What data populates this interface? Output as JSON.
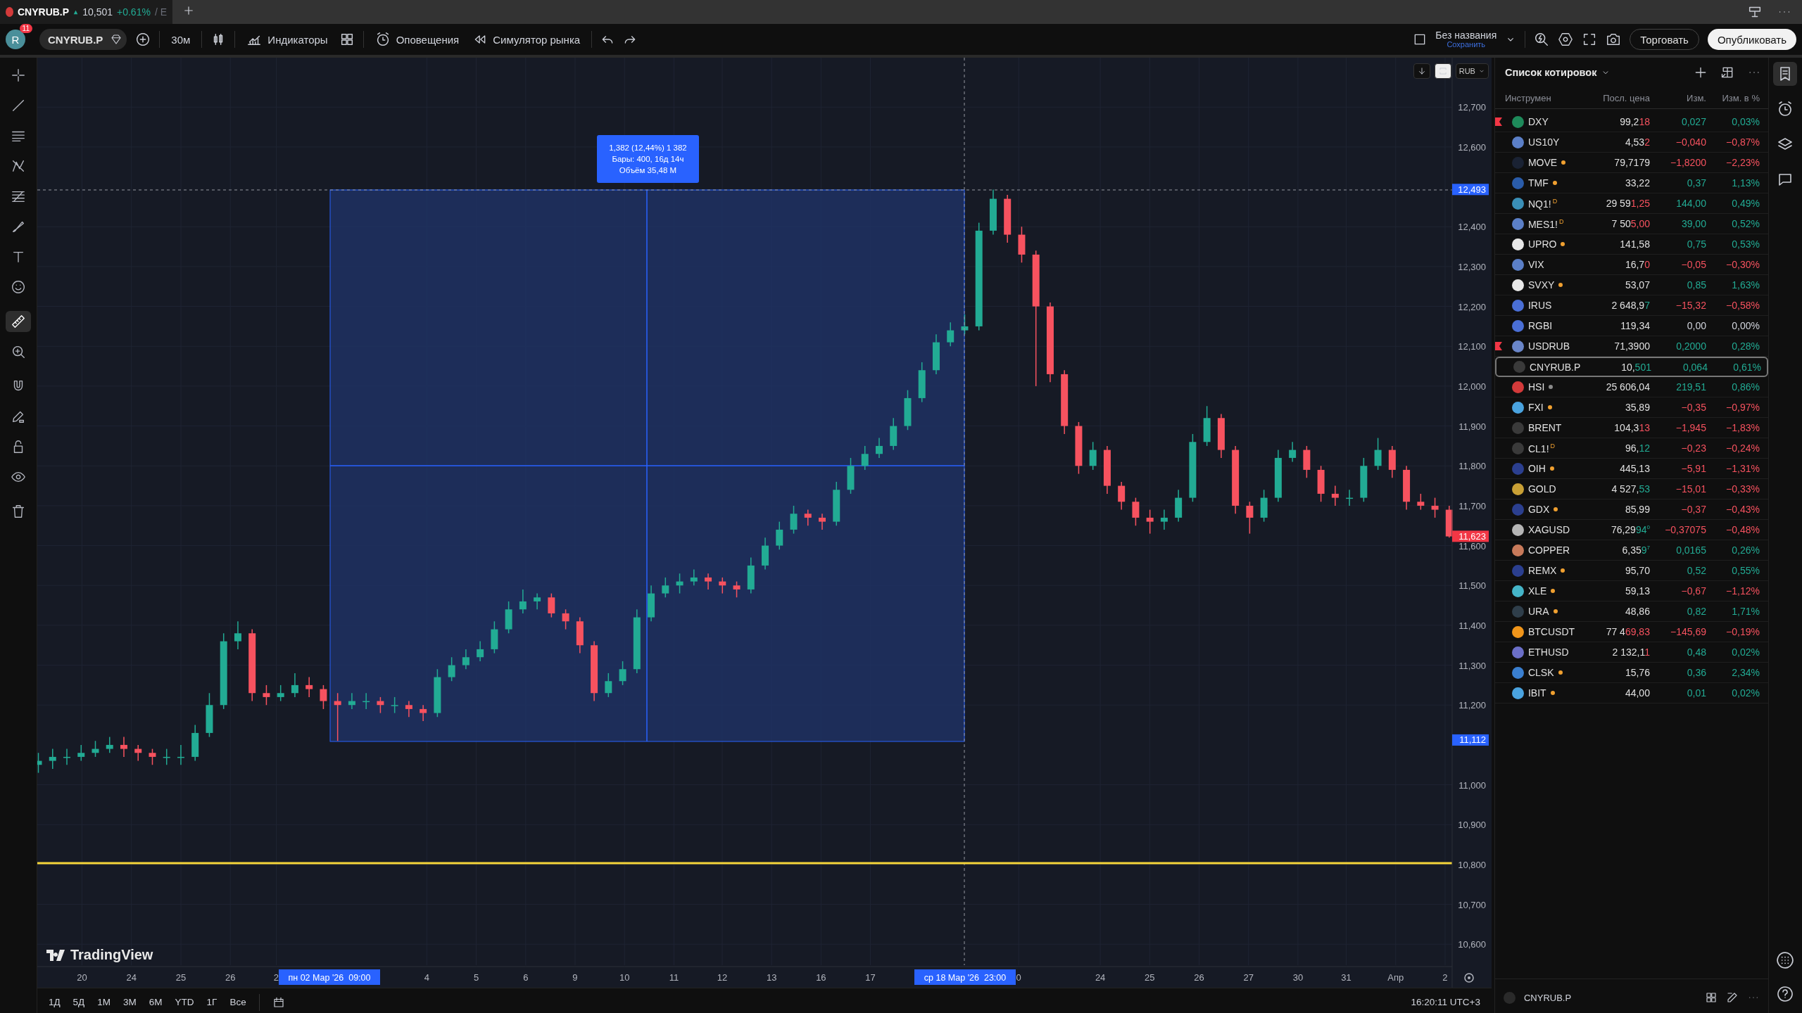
{
  "tab": {
    "symbol": "CNYRUB.P",
    "price": "10,501",
    "change": "+0.61%",
    "suffix": "/ E"
  },
  "toolbar": {
    "avatar": "R",
    "notifications": "11",
    "symbol": "CNYRUB.P",
    "interval": "30м",
    "indicators": "Индикаторы",
    "alerts": "Оповещения",
    "replay": "Симулятор рынка"
  },
  "layout": {
    "name": "Без названия",
    "save": "Сохранить",
    "trade": "Торговать",
    "publish": "Опубликовать"
  },
  "tools": [
    {
      "selected": false
    },
    {
      "selected": false
    },
    {
      "selected": false
    },
    {
      "selected": false
    },
    {
      "selected": false
    },
    {
      "selected": false
    },
    {
      "selected": false
    },
    {
      "selected": false
    },
    {
      "selected": true
    },
    {
      "selected": false
    },
    {
      "selected": false
    },
    {
      "selected": false
    },
    {
      "selected": false
    },
    {
      "selected": false
    },
    {
      "selected": false
    }
  ],
  "chart": {
    "currency": "RUB",
    "price_markers": [
      {
        "label": "12,493",
        "kind": "measure"
      },
      {
        "label": "11,623",
        "kind": "last"
      },
      {
        "label": "11,112",
        "kind": "measure"
      }
    ],
    "measure": [
      "1,382 (12,44%) 1 382",
      "Бары: 400, 16д 14ч",
      "Объём 35,48 M"
    ],
    "time_axis": [
      "20",
      "24",
      "25",
      "26",
      "2",
      "4",
      "5",
      "6",
      "9",
      "10",
      "11",
      "12",
      "13",
      "16",
      "17",
      "0",
      "24",
      "25",
      "26",
      "27",
      "30",
      "31",
      "Апр",
      "2"
    ],
    "time_markers": [
      "пн 02 Мар '26  09:00",
      "ср 18 Мар '26  23:00"
    ],
    "logo": "TradingView",
    "chart_data": {
      "type": "candlestick",
      "categories": [
        null,
        null,
        null,
        null,
        null,
        null,
        null,
        null,
        null,
        null,
        null,
        null,
        null,
        null,
        null,
        null,
        null,
        null,
        null,
        null,
        null,
        null,
        null,
        null,
        null,
        null,
        null,
        null,
        null,
        null,
        null,
        null,
        null,
        null,
        null,
        null,
        null,
        null,
        null,
        null,
        null,
        null,
        null,
        null,
        null,
        null,
        null,
        null,
        null,
        null,
        null,
        null,
        null,
        null,
        null,
        null,
        null,
        null,
        null,
        null,
        null,
        null,
        null,
        null,
        null,
        null,
        null,
        null,
        null,
        null,
        null,
        null,
        null,
        null,
        null,
        null,
        null,
        null,
        null,
        null,
        null,
        null,
        null,
        null,
        null,
        null,
        null,
        null,
        null,
        null,
        null,
        null,
        null,
        null,
        null,
        null,
        null,
        null,
        null,
        null
      ],
      "ylim": [
        10.491,
        12.824
      ],
      "yticks": [
        {
          "value": 12.7,
          "label": "12,700"
        },
        {
          "value": 12.6,
          "label": "12,600"
        },
        {
          "value": 12.4,
          "label": "12,400"
        },
        {
          "value": 12.3,
          "label": "12,300"
        },
        {
          "value": 12.2,
          "label": "12,200"
        },
        {
          "value": 12.1,
          "label": "12,100"
        },
        {
          "value": 12.0,
          "label": "12,000"
        },
        {
          "value": 11.9,
          "label": "11,900"
        },
        {
          "value": 11.8,
          "label": "11,800"
        },
        {
          "value": 11.7,
          "label": "11,700"
        },
        {
          "value": 11.6,
          "label": "11,600"
        },
        {
          "value": 11.5,
          "label": "11,500"
        },
        {
          "value": 11.4,
          "label": "11,400"
        },
        {
          "value": 11.3,
          "label": "11,300"
        },
        {
          "value": 11.2,
          "label": "11,200"
        },
        {
          "value": 11.0,
          "label": "11,000"
        },
        {
          "value": 10.9,
          "label": "10,900"
        },
        {
          "value": 10.8,
          "label": "10,800"
        },
        {
          "value": 10.7,
          "label": "10,700"
        },
        {
          "value": 10.6,
          "label": "10,600"
        }
      ],
      "ohlc": [
        [
          11.05,
          11.08,
          11.03,
          11.06
        ],
        [
          11.06,
          11.09,
          11.04,
          11.07
        ],
        [
          11.07,
          11.09,
          11.05,
          11.07
        ],
        [
          11.07,
          11.1,
          11.06,
          11.08
        ],
        [
          11.08,
          11.11,
          11.07,
          11.09
        ],
        [
          11.09,
          11.12,
          11.08,
          11.1
        ],
        [
          11.1,
          11.12,
          11.07,
          11.09
        ],
        [
          11.09,
          11.1,
          11.06,
          11.08
        ],
        [
          11.08,
          11.09,
          11.05,
          11.07
        ],
        [
          11.07,
          11.09,
          11.05,
          11.07
        ],
        [
          11.07,
          11.1,
          11.05,
          11.07
        ],
        [
          11.07,
          11.15,
          11.06,
          11.13
        ],
        [
          11.13,
          11.23,
          11.12,
          11.2
        ],
        [
          11.2,
          11.38,
          11.19,
          11.36
        ],
        [
          11.36,
          11.41,
          11.34,
          11.38
        ],
        [
          11.38,
          11.39,
          11.21,
          11.23
        ],
        [
          11.23,
          11.25,
          11.2,
          11.22
        ],
        [
          11.22,
          11.25,
          11.21,
          11.23
        ],
        [
          11.23,
          11.28,
          11.22,
          11.25
        ],
        [
          11.25,
          11.27,
          11.22,
          11.24
        ],
        [
          11.24,
          11.25,
          11.19,
          11.21
        ],
        [
          11.21,
          11.23,
          11.11,
          11.2
        ],
        [
          11.2,
          11.23,
          11.19,
          11.21
        ],
        [
          11.21,
          11.23,
          11.19,
          11.21
        ],
        [
          11.21,
          11.22,
          11.18,
          11.2
        ],
        [
          11.2,
          11.22,
          11.18,
          11.2
        ],
        [
          11.2,
          11.21,
          11.17,
          11.19
        ],
        [
          11.19,
          11.2,
          11.16,
          11.18
        ],
        [
          11.18,
          11.29,
          11.17,
          11.27
        ],
        [
          11.27,
          11.32,
          11.26,
          11.3
        ],
        [
          11.3,
          11.34,
          11.29,
          11.32
        ],
        [
          11.32,
          11.36,
          11.31,
          11.34
        ],
        [
          11.34,
          11.41,
          11.33,
          11.39
        ],
        [
          11.39,
          11.46,
          11.38,
          11.44
        ],
        [
          11.44,
          11.49,
          11.43,
          11.46
        ],
        [
          11.46,
          11.48,
          11.44,
          11.47
        ],
        [
          11.47,
          11.48,
          11.42,
          11.43
        ],
        [
          11.43,
          11.44,
          11.39,
          11.41
        ],
        [
          11.41,
          11.42,
          11.33,
          11.35
        ],
        [
          11.35,
          11.36,
          11.21,
          11.23
        ],
        [
          11.23,
          11.28,
          11.22,
          11.26
        ],
        [
          11.26,
          11.31,
          11.25,
          11.29
        ],
        [
          11.29,
          11.44,
          11.28,
          11.42
        ],
        [
          11.42,
          11.5,
          11.41,
          11.48
        ],
        [
          11.48,
          11.52,
          11.47,
          11.5
        ],
        [
          11.5,
          11.53,
          11.48,
          11.51
        ],
        [
          11.51,
          11.54,
          11.5,
          11.52
        ],
        [
          11.52,
          11.53,
          11.49,
          11.51
        ],
        [
          11.51,
          11.52,
          11.48,
          11.5
        ],
        [
          11.5,
          11.51,
          11.47,
          11.49
        ],
        [
          11.49,
          11.57,
          11.48,
          11.55
        ],
        [
          11.55,
          11.62,
          11.54,
          11.6
        ],
        [
          11.6,
          11.66,
          11.59,
          11.64
        ],
        [
          11.64,
          11.7,
          11.63,
          11.68
        ],
        [
          11.68,
          11.69,
          11.65,
          11.67
        ],
        [
          11.67,
          11.68,
          11.64,
          11.66
        ],
        [
          11.66,
          11.76,
          11.65,
          11.74
        ],
        [
          11.74,
          11.82,
          11.73,
          11.8
        ],
        [
          11.8,
          11.85,
          11.79,
          11.83
        ],
        [
          11.83,
          11.87,
          11.82,
          11.85
        ],
        [
          11.85,
          11.92,
          11.84,
          11.9
        ],
        [
          11.9,
          11.99,
          11.89,
          11.97
        ],
        [
          11.97,
          12.06,
          11.96,
          12.04
        ],
        [
          12.04,
          12.13,
          12.03,
          12.11
        ],
        [
          12.11,
          12.16,
          12.1,
          12.14
        ],
        [
          12.14,
          12.18,
          12.13,
          12.15
        ],
        [
          12.15,
          12.41,
          12.14,
          12.39
        ],
        [
          12.39,
          12.493,
          12.38,
          12.47
        ],
        [
          12.47,
          12.48,
          12.36,
          12.38
        ],
        [
          12.38,
          12.4,
          12.31,
          12.33
        ],
        [
          12.33,
          12.34,
          12.0,
          12.2
        ],
        [
          12.2,
          12.21,
          12.01,
          12.03
        ],
        [
          12.03,
          12.04,
          11.88,
          11.9
        ],
        [
          11.9,
          11.91,
          11.78,
          11.8
        ],
        [
          11.8,
          11.86,
          11.79,
          11.84
        ],
        [
          11.84,
          11.85,
          11.73,
          11.75
        ],
        [
          11.75,
          11.76,
          11.69,
          11.71
        ],
        [
          11.71,
          11.72,
          11.65,
          11.67
        ],
        [
          11.67,
          11.69,
          11.63,
          11.66
        ],
        [
          11.66,
          11.69,
          11.64,
          11.67
        ],
        [
          11.67,
          11.74,
          11.66,
          11.72
        ],
        [
          11.72,
          11.88,
          11.71,
          11.86
        ],
        [
          11.86,
          11.95,
          11.85,
          11.92
        ],
        [
          11.92,
          11.93,
          11.82,
          11.84
        ],
        [
          11.84,
          11.85,
          11.68,
          11.7
        ],
        [
          11.7,
          11.71,
          11.63,
          11.67
        ],
        [
          11.67,
          11.74,
          11.66,
          11.72
        ],
        [
          11.72,
          11.84,
          11.71,
          11.82
        ],
        [
          11.82,
          11.86,
          11.81,
          11.84
        ],
        [
          11.84,
          11.85,
          11.77,
          11.79
        ],
        [
          11.79,
          11.8,
          11.71,
          11.73
        ],
        [
          11.73,
          11.75,
          11.7,
          11.72
        ],
        [
          11.72,
          11.74,
          11.7,
          11.72
        ],
        [
          11.72,
          11.82,
          11.71,
          11.8
        ],
        [
          11.8,
          11.87,
          11.79,
          11.84
        ],
        [
          11.84,
          11.85,
          11.77,
          11.79
        ],
        [
          11.79,
          11.8,
          11.69,
          11.71
        ],
        [
          11.71,
          11.73,
          11.69,
          11.7
        ],
        [
          11.7,
          11.72,
          11.67,
          11.69
        ],
        [
          11.69,
          11.7,
          11.62,
          11.623
        ]
      ]
    }
  },
  "bottom": {
    "ranges": [
      "1Д",
      "5Д",
      "1М",
      "3М",
      "6М",
      "YTD",
      "1Г",
      "Все"
    ],
    "clock": "16:20:11 UTC+3"
  },
  "watchlist": {
    "title": "Список котировок",
    "columns": [
      "Инструмен",
      "Посл. цена",
      "Изм.",
      "Изм. в %"
    ],
    "rows": [
      {
        "symbol": "DXY",
        "color": "#1e8a5a",
        "flagged": true,
        "price": "99,2",
        "tail": {
          "text": "18",
          "color": "#f7525f"
        },
        "change": {
          "text": "0,027",
          "pct": "0,03%",
          "color": "#22ab94"
        },
        "selected": false
      },
      {
        "symbol": "US10Y",
        "color": "#5b7fc7",
        "flagged": false,
        "price": "4,53",
        "tail": {
          "text": "2",
          "color": "#f7525f"
        },
        "change": {
          "text": "−0,040",
          "pct": "−0,87%",
          "color": "#f7525f"
        },
        "selected": false
      },
      {
        "symbol": "MOVE",
        "color": "#1a2233",
        "flagged": false,
        "dot": {
          "color": "#f0a030"
        },
        "price": "79,7179",
        "change": {
          "text": "−1,8200",
          "pct": "−2,23%",
          "color": "#f7525f"
        },
        "selected": false
      },
      {
        "symbol": "TMF",
        "color": "#2a5caa",
        "flagged": false,
        "dot": {
          "color": "#f0a030"
        },
        "price": "33,22",
        "change": {
          "text": "0,37",
          "pct": "1,13%",
          "color": "#22ab94"
        },
        "selected": false
      },
      {
        "symbol": "NQ1!$^{D}$",
        "color": "#3a8fb7",
        "flagged": false,
        "price": "29 59",
        "tail": {
          "text": "1,25",
          "color": "#f7525f"
        },
        "change": {
          "text": "144,00",
          "pct": "0,49%",
          "color": "#22ab94"
        },
        "selected": false
      },
      {
        "symbol": "MES1!$^{D}$",
        "color": "#5b7fc7",
        "flagged": false,
        "price": "7 50",
        "tail": {
          "text": "5,00",
          "color": "#f7525f"
        },
        "change": {
          "text": "39,00",
          "pct": "0,52%",
          "color": "#22ab94"
        },
        "selected": false
      },
      {
        "symbol": "UPRO",
        "color": "#e8e8e8",
        "flagged": false,
        "dot": {
          "color": "#f0a030"
        },
        "price": "141,58",
        "change": {
          "text": "0,75",
          "pct": "0,53%",
          "color": "#22ab94"
        },
        "selected": false
      },
      {
        "symbol": "VIX",
        "color": "#5b7fc7",
        "flagged": false,
        "price": "16,7",
        "tail": {
          "text": "0",
          "color": "#f7525f"
        },
        "change": {
          "text": "−0,05",
          "pct": "−0,30%",
          "color": "#f7525f"
        },
        "selected": false
      },
      {
        "symbol": "SVXY",
        "color": "#e8e8e8",
        "flagged": false,
        "dot": {
          "color": "#f0a030"
        },
        "price": "53,07",
        "change": {
          "text": "0,85",
          "pct": "1,63%",
          "color": "#22ab94"
        },
        "selected": false
      },
      {
        "symbol": "IRUS",
        "color": "#4a6fd6",
        "flagged": false,
        "price": "2 648,9",
        "tail": {
          "text": "7",
          "color": "#22ab94"
        },
        "change": {
          "text": "−15,32",
          "pct": "−0,58%",
          "color": "#f7525f"
        },
        "selected": false
      },
      {
        "symbol": "RGBI",
        "color": "#4a6fd6",
        "flagged": false,
        "price": "119,34",
        "change": {
          "text": "0,00",
          "pct": "0,00%",
          "color": "#d1d4dc"
        },
        "selected": false
      },
      {
        "symbol": "USDRUB",
        "color": "#6a86c9",
        "flagged": true,
        "price": "71,3900",
        "change": {
          "text": "0,2000",
          "pct": "0,28%",
          "color": "#22ab94"
        },
        "selected": false
      },
      {
        "symbol": "CNYRUB.P",
        "color": "#3a3a3a",
        "flagged": false,
        "price": "10,",
        "tail": {
          "text": "501",
          "color": "#22ab94"
        },
        "change": {
          "text": "0,064",
          "pct": "0,61%",
          "color": "#22ab94"
        },
        "selected": true
      },
      {
        "symbol": "HSI",
        "color": "#d33a3a",
        "flagged": false,
        "dot": {
          "color": "#8a8a8a"
        },
        "price": "25 606,04",
        "change": {
          "text": "219,51",
          "pct": "0,86%",
          "color": "#22ab94"
        },
        "selected": false
      },
      {
        "symbol": "FXI",
        "color": "#4aa3df",
        "flagged": false,
        "dot": {
          "color": "#f0a030"
        },
        "price": "35,89",
        "change": {
          "text": "−0,35",
          "pct": "−0,97%",
          "color": "#f7525f"
        },
        "selected": false
      },
      {
        "symbol": "BRENT",
        "color": "#3a3a3a",
        "flagged": false,
        "price": "104,3",
        "tail": {
          "text": "13",
          "color": "#f7525f"
        },
        "change": {
          "text": "−1,945",
          "pct": "−1,83%",
          "color": "#f7525f"
        },
        "selected": false
      },
      {
        "symbol": "CL1!$^{D}$",
        "color": "#3a3a3a",
        "flagged": false,
        "price": "96,",
        "tail": {
          "text": "12",
          "color": "#22ab94"
        },
        "change": {
          "text": "−0,23",
          "pct": "−0,24%",
          "color": "#f7525f"
        },
        "selected": false
      },
      {
        "symbol": "OIH",
        "color": "#2b3f8f",
        "flagged": false,
        "dot": {
          "color": "#f0a030"
        },
        "price": "445,13",
        "change": {
          "text": "−5,91",
          "pct": "−1,31%",
          "color": "#f7525f"
        },
        "selected": false
      },
      {
        "symbol": "GOLD",
        "color": "#c9a035",
        "flagged": false,
        "price": "4 527,",
        "tail": {
          "text": "53",
          "color": "#22ab94"
        },
        "change": {
          "text": "−15,01",
          "pct": "−0,33%",
          "color": "#f7525f"
        },
        "selected": false
      },
      {
        "symbol": "GDX",
        "color": "#2b3f8f",
        "flagged": false,
        "dot": {
          "color": "#f0a030"
        },
        "price": "85,99",
        "change": {
          "text": "−0,37",
          "pct": "−0,43%",
          "color": "#f7525f"
        },
        "selected": false
      },
      {
        "symbol": "XAGUSD",
        "color": "#b5b5b5",
        "flagged": false,
        "price": "76,29",
        "tail": {
          "text": "94$^{0}$",
          "color": "#22ab94"
        },
        "change": {
          "text": "−0,37075",
          "pct": "−0,48%",
          "color": "#f7525f"
        },
        "selected": false
      },
      {
        "symbol": "COPPER",
        "color": "#c87a5a",
        "flagged": false,
        "price": "6,35",
        "tail": {
          "text": "9$^{7}$",
          "color": "#22ab94"
        },
        "change": {
          "text": "0,0165",
          "pct": "0,26%",
          "color": "#22ab94"
        },
        "selected": false
      },
      {
        "symbol": "REMX",
        "color": "#2b3f8f",
        "flagged": false,
        "dot": {
          "color": "#f0a030"
        },
        "price": "95,70",
        "change": {
          "text": "0,52",
          "pct": "0,55%",
          "color": "#22ab94"
        },
        "selected": false
      },
      {
        "symbol": "XLE",
        "color": "#45b5c8",
        "flagged": false,
        "dot": {
          "color": "#f0a030"
        },
        "price": "59,13",
        "change": {
          "text": "−0,67",
          "pct": "−1,12%",
          "color": "#f7525f"
        },
        "selected": false
      },
      {
        "symbol": "URA",
        "color": "#2f3e4a",
        "flagged": false,
        "dot": {
          "color": "#f0a030"
        },
        "price": "48,86",
        "change": {
          "text": "0,82",
          "pct": "1,71%",
          "color": "#22ab94"
        },
        "selected": false
      },
      {
        "symbol": "BTCUSDT",
        "color": "#f0951a",
        "flagged": false,
        "price": "77 4",
        "tail": {
          "text": "69,83",
          "color": "#f7525f"
        },
        "change": {
          "text": "−145,69",
          "pct": "−0,19%",
          "color": "#f7525f"
        },
        "selected": false
      },
      {
        "symbol": "ETHUSD",
        "color": "#6b6fc8",
        "flagged": false,
        "price": "2 132,1",
        "tail": {
          "text": "1",
          "color": "#f7525f"
        },
        "change": {
          "text": "0,48",
          "pct": "0,02%",
          "color": "#22ab94"
        },
        "selected": false
      },
      {
        "symbol": "CLSK",
        "color": "#3a7fd0",
        "flagged": false,
        "dot": {
          "color": "#f0a030"
        },
        "price": "15,76",
        "change": {
          "text": "0,36",
          "pct": "2,34%",
          "color": "#22ab94"
        },
        "selected": false
      },
      {
        "symbol": "IBIT",
        "color": "#4aa3df",
        "flagged": false,
        "dot": {
          "color": "#f0a030"
        },
        "price": "44,00",
        "change": {
          "text": "0,01",
          "pct": "0,02%",
          "color": "#22ab94"
        },
        "selected": false
      }
    ],
    "footer_symbol": "CNYRUB.P"
  }
}
